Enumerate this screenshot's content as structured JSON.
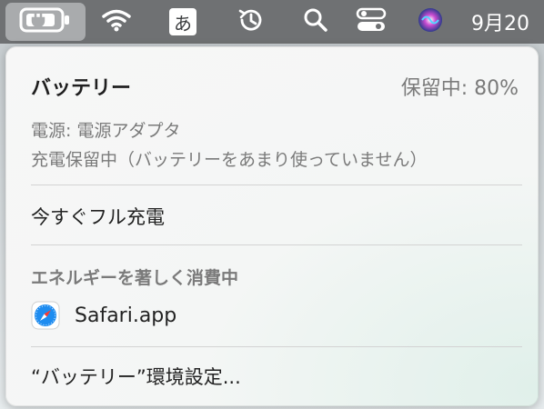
{
  "menubar": {
    "icons": {
      "battery": "battery-charging-icon",
      "wifi": "wifi-icon",
      "time_machine": "time-machine-icon",
      "spotlight": "search-icon",
      "control_center": "control-center-icon",
      "siri": "siri-icon"
    },
    "ime_label": "あ",
    "clock": "9月20"
  },
  "battery_menu": {
    "title": "バッテリー",
    "status": "保留中: 80%",
    "power_source": "電源: 電源アダプタ",
    "charge_hold_note": "充電保留中（バッテリーをあまり使っていません）",
    "charge_now": "今すぐフル充電",
    "energy_header": "エネルギーを著しく消費中",
    "apps": [
      {
        "name": "Safari.app",
        "icon": "safari-icon"
      }
    ],
    "preferences": "“バッテリー”環境設定..."
  },
  "colors": {
    "menubar": "#6f7173",
    "menu_bg": "#f7f7f7",
    "muted_text": "#7a7a7a"
  }
}
